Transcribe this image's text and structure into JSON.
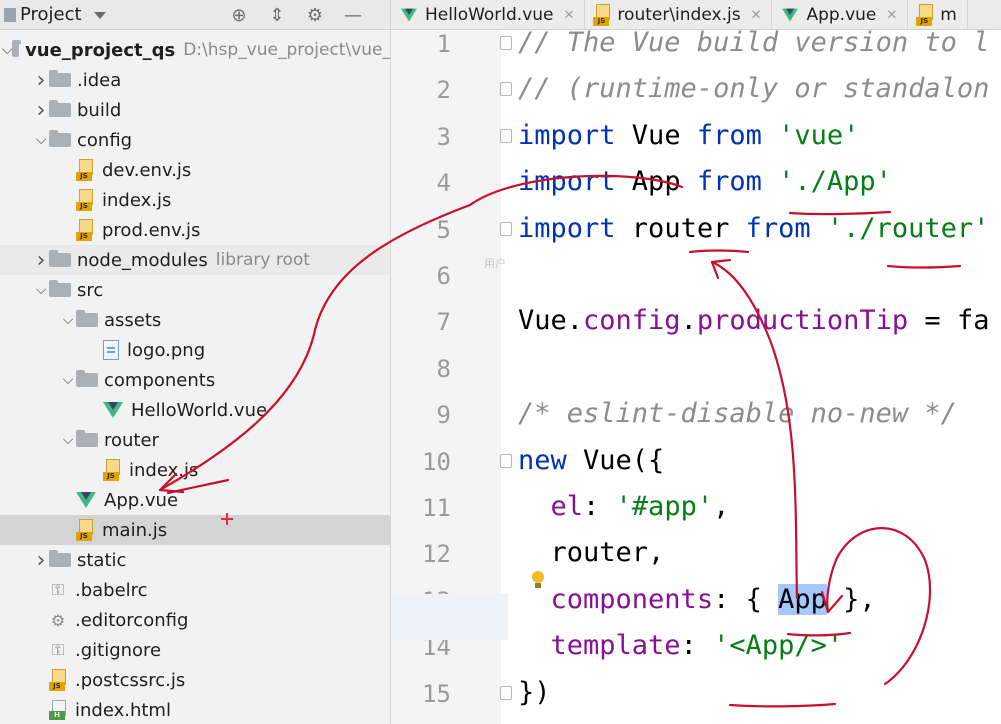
{
  "project_panel": {
    "title": "Project",
    "toolbar_icons": [
      "target-icon",
      "collapse-icon",
      "gear-icon",
      "minimize-icon"
    ],
    "tree": [
      {
        "label": "vue_project_qs",
        "path": "D:\\hsp_vue_project\\vue_",
        "icon": "folder",
        "expanded": true,
        "depth": 0
      },
      {
        "label": ".idea",
        "icon": "folder",
        "expanded": false,
        "depth": 1
      },
      {
        "label": "build",
        "icon": "folder",
        "expanded": false,
        "depth": 1
      },
      {
        "label": "config",
        "icon": "folder",
        "expanded": true,
        "depth": 1
      },
      {
        "label": "dev.env.js",
        "icon": "js",
        "depth": 2
      },
      {
        "label": "index.js",
        "icon": "js",
        "depth": 2
      },
      {
        "label": "prod.env.js",
        "icon": "js",
        "depth": 2
      },
      {
        "label": "node_modules",
        "hint": "library root",
        "icon": "folder",
        "expanded": false,
        "depth": 1
      },
      {
        "label": "src",
        "icon": "folder",
        "expanded": true,
        "depth": 1
      },
      {
        "label": "assets",
        "icon": "folder",
        "expanded": true,
        "depth": 2
      },
      {
        "label": "logo.png",
        "icon": "png",
        "depth": 3
      },
      {
        "label": "components",
        "icon": "folder",
        "expanded": true,
        "depth": 2
      },
      {
        "label": "HelloWorld.vue",
        "icon": "vue",
        "depth": 3
      },
      {
        "label": "router",
        "icon": "folder",
        "expanded": true,
        "depth": 2
      },
      {
        "label": "index.js",
        "icon": "js",
        "depth": 3
      },
      {
        "label": "App.vue",
        "icon": "vue",
        "depth": 2
      },
      {
        "label": "main.js",
        "icon": "js",
        "depth": 2,
        "selected": true
      },
      {
        "label": "static",
        "icon": "folder",
        "expanded": false,
        "depth": 1
      },
      {
        "label": ".babelrc",
        "icon": "config",
        "depth": 1
      },
      {
        "label": ".editorconfig",
        "icon": "gear",
        "depth": 1
      },
      {
        "label": ".gitignore",
        "icon": "config",
        "depth": 1
      },
      {
        "label": ".postcssrc.js",
        "icon": "js",
        "depth": 1
      },
      {
        "label": "index.html",
        "icon": "html",
        "depth": 1
      }
    ]
  },
  "tabs": [
    {
      "label": "HelloWorld.vue",
      "icon": "vue"
    },
    {
      "label": "router\\index.js",
      "icon": "js"
    },
    {
      "label": "App.vue",
      "icon": "vue"
    },
    {
      "label": "m",
      "icon": "js"
    }
  ],
  "editor": {
    "line_numbers": [
      "1",
      "2",
      "3",
      "4",
      "5",
      "6",
      "7",
      "8",
      "9",
      "10",
      "11",
      "12",
      "13",
      "14",
      "15"
    ],
    "highlighted_line": 13,
    "watermark": "用户",
    "lines": [
      [
        {
          "t": "// The Vue build version to l",
          "c": "cmt"
        }
      ],
      [
        {
          "t": "// (runtime-only or standalon",
          "c": "cmt"
        }
      ],
      [
        {
          "t": "import",
          "c": "kw"
        },
        {
          "t": " Vue ",
          "c": ""
        },
        {
          "t": "from",
          "c": "kw"
        },
        {
          "t": " 'vue'",
          "c": "str"
        }
      ],
      [
        {
          "t": "import",
          "c": "kw"
        },
        {
          "t": " App ",
          "c": ""
        },
        {
          "t": "from",
          "c": "kw"
        },
        {
          "t": " './App'",
          "c": "str"
        }
      ],
      [
        {
          "t": "import",
          "c": "kw"
        },
        {
          "t": " router ",
          "c": ""
        },
        {
          "t": "from",
          "c": "kw"
        },
        {
          "t": " './router'",
          "c": "str"
        }
      ],
      [],
      [
        {
          "t": "Vue.",
          "c": ""
        },
        {
          "t": "config",
          "c": "prop"
        },
        {
          "t": ".",
          "c": ""
        },
        {
          "t": "productionTip",
          "c": "prop"
        },
        {
          "t": " = fa",
          "c": ""
        }
      ],
      [],
      [
        {
          "t": "/* eslint-disable no-new */",
          "c": "cmt"
        }
      ],
      [
        {
          "t": "new",
          "c": "kw"
        },
        {
          "t": " Vue({",
          "c": ""
        }
      ],
      [
        {
          "t": "  ",
          "c": ""
        },
        {
          "t": "el",
          "c": "prop"
        },
        {
          "t": ": ",
          "c": ""
        },
        {
          "t": "'#app'",
          "c": "str"
        },
        {
          "t": ",",
          "c": ""
        }
      ],
      [
        {
          "t": "  router,",
          "c": ""
        }
      ],
      [
        {
          "t": "  ",
          "c": ""
        },
        {
          "t": "components",
          "c": "prop"
        },
        {
          "t": ": { ",
          "c": ""
        },
        {
          "t": "App",
          "c": "sel"
        },
        {
          "t": " },",
          "c": ""
        }
      ],
      [
        {
          "t": "  ",
          "c": ""
        },
        {
          "t": "template",
          "c": "prop"
        },
        {
          "t": ": ",
          "c": ""
        },
        {
          "t": "'<App/>'",
          "c": "str"
        }
      ],
      [
        {
          "t": "})",
          "c": ""
        }
      ]
    ]
  },
  "annotations": {
    "color": "#c8102e"
  },
  "colors": {
    "keyword": "#0033b3",
    "string": "#067d17",
    "property": "#871094",
    "comment": "#8c8c8c",
    "selection": "#a6c8ff"
  }
}
